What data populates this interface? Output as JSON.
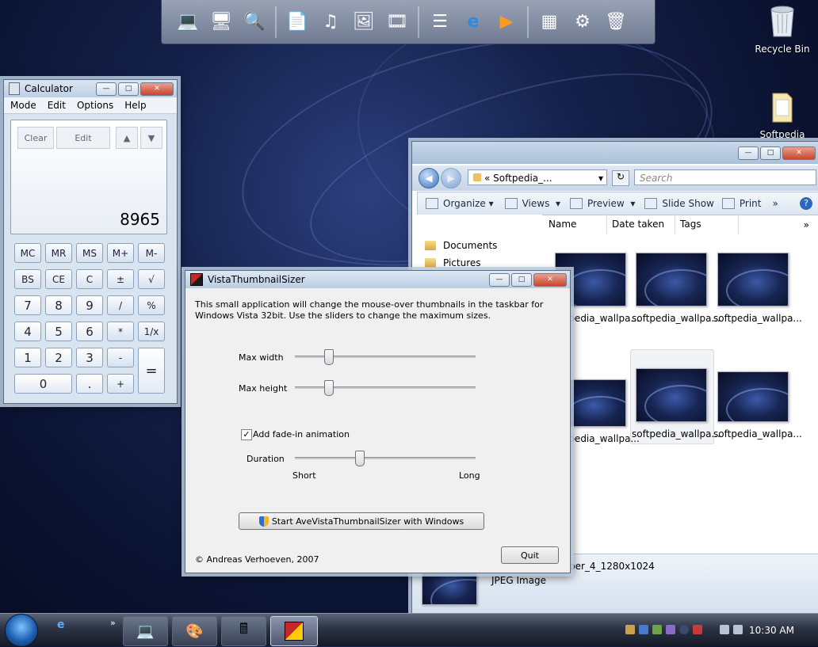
{
  "desktop": {
    "icons": [
      {
        "label": "Recycle Bin",
        "icon": "recycle-bin-icon"
      },
      {
        "label": "Softpedia",
        "icon": "folder-icon"
      }
    ]
  },
  "dock": {
    "icons": [
      "computer-icon",
      "network-icon",
      "search-icon",
      "document-icon",
      "music-icon",
      "pictures-icon",
      "video-icon",
      "tasks-icon",
      "internet-explorer-icon",
      "media-player-icon",
      "control-panel-icon",
      "gear-icon",
      "recycle-bin-icon"
    ]
  },
  "calculator": {
    "title": "Calculator",
    "menu": [
      "Mode",
      "Edit",
      "Options",
      "Help"
    ],
    "history_buttons": [
      "Clear",
      "Edit"
    ],
    "display": "8965",
    "keys": {
      "mc": "MC",
      "mr": "MR",
      "ms": "MS",
      "mplus": "M+",
      "mminus": "M-",
      "bs": "BS",
      "ce": "CE",
      "c": "C",
      "pm": "±",
      "sqrt": "√",
      "k7": "7",
      "k8": "8",
      "k9": "9",
      "div": "/",
      "pct": "%",
      "k4": "4",
      "k5": "5",
      "k6": "6",
      "mul": "*",
      "inv": "1/x",
      "k1": "1",
      "k2": "2",
      "k3": "3",
      "sub": "-",
      "eq": "=",
      "k0": "0",
      "dot": ".",
      "add": "+"
    }
  },
  "explorer": {
    "address": "« Softpedia_...",
    "search_placeholder": "Search",
    "toolbar": [
      "Organize",
      "Views",
      "Preview",
      "Slide Show",
      "Print"
    ],
    "more": "»",
    "nav": [
      "Documents",
      "Pictures"
    ],
    "columns": [
      "Name",
      "Date taken",
      "Tags"
    ],
    "thumbnails": [
      "softpedia_wallpa...",
      "softpedia_wallpa...",
      "softpedia_wallpa...",
      "softpedia_wallpa...",
      "softpedia_wallpa...",
      "softpedia_wallpa..."
    ],
    "details": {
      "filename_tail": "per_4_1280x1024",
      "type": "JPEG Image"
    }
  },
  "sizer": {
    "title": "VistaThumbnailSizer",
    "description": "This small application will change the mouse-over thumbnails in the taskbar for Windows Vista 32bit. Use the sliders to change the maximum sizes.",
    "max_width_label": "Max width",
    "max_height_label": "Max height",
    "fade_label": "Add fade-in animation",
    "fade_checked": true,
    "duration_label": "Duration",
    "short_label": "Short",
    "long_label": "Long",
    "max_width_value": 0.17,
    "max_height_value": 0.17,
    "duration_value": 0.35,
    "start_button": "Start AveVistaThumbnailSizer with Windows",
    "copyright": "© Andreas Verhoeven, 2007",
    "quit_button": "Quit"
  },
  "taskbar": {
    "clock": "10:30 AM",
    "chevron": "»",
    "tasks": [
      "computer-icon",
      "paint-icon",
      "calculator-icon",
      "sizer-icon"
    ]
  },
  "colors": {
    "accent": "#1d5fb0",
    "desktop": "#0b1230"
  }
}
